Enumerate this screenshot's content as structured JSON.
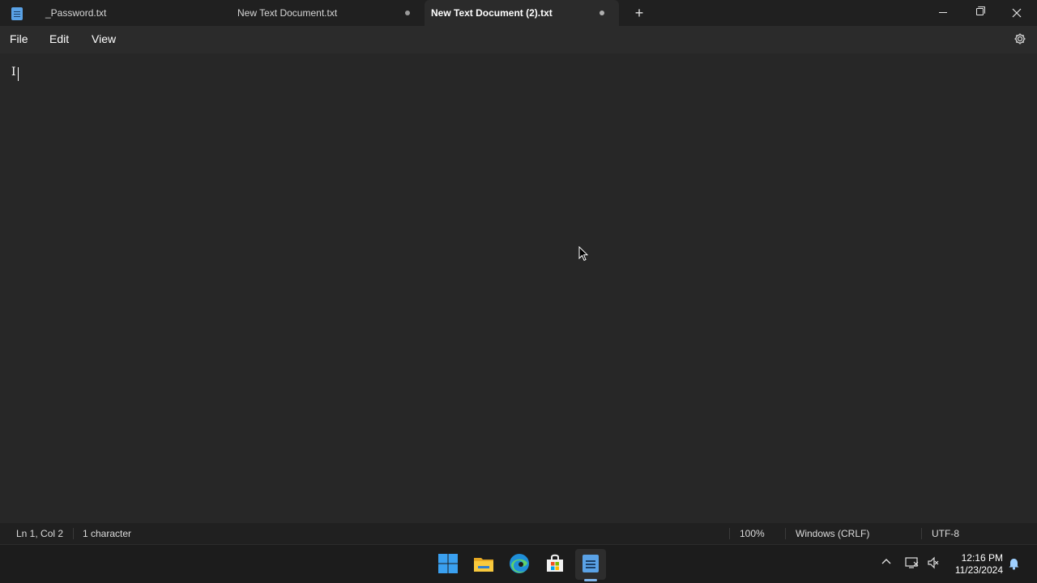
{
  "window": {
    "tabs": [
      {
        "label": "_Password.txt",
        "modified": false,
        "active": false
      },
      {
        "label": "New Text Document.txt",
        "modified": true,
        "active": false
      },
      {
        "label": "New Text Document (2).txt",
        "modified": true,
        "active": true
      }
    ],
    "new_tab_label": "+",
    "icons": {
      "app": "notepad-icon",
      "minimize": "minimize-icon",
      "maximize": "restore-icon",
      "close": "close-icon",
      "settings": "gear-icon"
    }
  },
  "menubar": {
    "items": [
      "File",
      "Edit",
      "View"
    ]
  },
  "editor": {
    "content": "I"
  },
  "statusbar": {
    "position": "Ln 1, Col 2",
    "characters": "1 character",
    "zoom": "100%",
    "line_endings": "Windows (CRLF)",
    "encoding": "UTF-8"
  },
  "taskbar": {
    "apps": [
      "start-icon",
      "file-explorer-icon",
      "edge-icon",
      "microsoft-store-icon",
      "notepad-icon"
    ],
    "clock": {
      "time": "12:16 PM",
      "date": "11/23/2024"
    }
  },
  "colors": {
    "background": "#202020",
    "editor": "#272727",
    "accent": "#5aa2e6"
  }
}
